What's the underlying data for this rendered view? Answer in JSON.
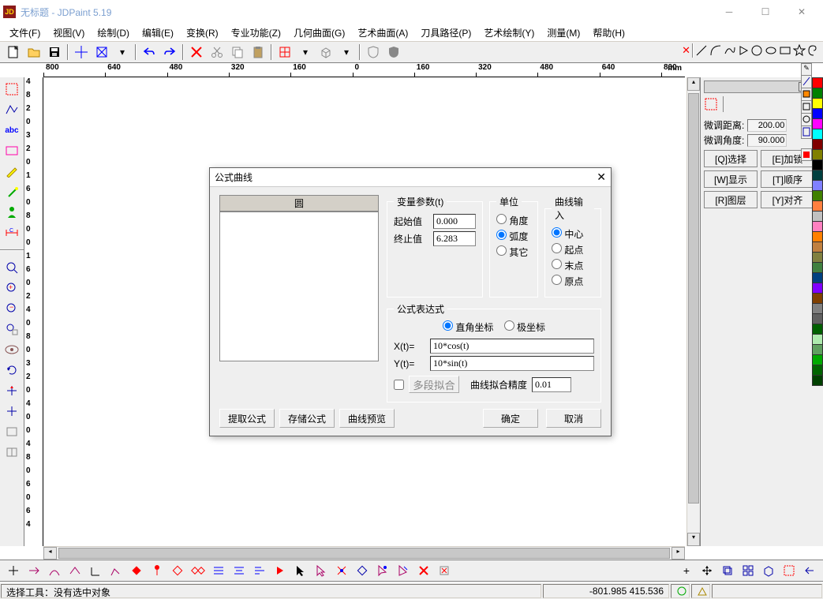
{
  "titlebar": {
    "title": "无标题 - JDPaint 5.19"
  },
  "menu": [
    "文件(F)",
    "视图(V)",
    "绘制(D)",
    "编辑(E)",
    "变换(R)",
    "专业功能(Z)",
    "几何曲面(G)",
    "艺术曲面(A)",
    "刀具路径(P)",
    "艺术绘制(Y)",
    "测量(M)",
    "帮助(H)"
  ],
  "ruler_h": {
    "labels": [
      "800",
      "640",
      "480",
      "320",
      "160",
      "0",
      "160",
      "320",
      "480",
      "640",
      "800"
    ],
    "unit": "mm"
  },
  "ruler_v": {
    "labels": [
      "4",
      "8",
      "2",
      "0",
      "3",
      "2",
      "0",
      "1",
      "6",
      "0",
      "8",
      "0",
      "0",
      "1",
      "6",
      "0",
      "2",
      "4",
      "0",
      "8",
      "0",
      "3",
      "2",
      "0",
      "4",
      "0",
      "0",
      "4",
      "8",
      "0",
      "6",
      "0",
      "6",
      "4"
    ]
  },
  "right_panel": {
    "dist_label": "微调距离:",
    "dist_value": "200.00",
    "angle_label": "微调角度:",
    "angle_value": "90.000",
    "buttons": [
      "[Q]选择",
      "[E]加锁",
      "[W]显示",
      "[T]顺序",
      "[R]图层",
      "[Y]对齐"
    ]
  },
  "dialog": {
    "title": "公式曲线",
    "list_header": "圆",
    "group_var": "变量参数(t)",
    "start_label": "起始值",
    "start_value": "0.000",
    "end_label": "终止值",
    "end_value": "6.283",
    "group_unit": "单位",
    "unit_options": [
      "角度",
      "弧度",
      "其它"
    ],
    "unit_selected": "弧度",
    "group_input": "曲线输入",
    "input_options": [
      "中心",
      "起点",
      "末点",
      "原点"
    ],
    "input_selected": "中心",
    "group_expr": "公式表达式",
    "coord_options": [
      "直角坐标",
      "极坐标"
    ],
    "coord_selected": "直角坐标",
    "x_label": "X(t)=",
    "x_value": "10*cos(t)",
    "y_label": "Y(t)=",
    "y_value": "10*sin(t)",
    "multi_label": "多段拟合",
    "precision_label": "曲线拟合精度",
    "precision_value": "0.01",
    "btn_extract": "提取公式",
    "btn_save": "存储公式",
    "btn_preview": "曲线预览",
    "btn_ok": "确定",
    "btn_cancel": "取消"
  },
  "status": {
    "left": "选择工具：没有选中对象",
    "coords": "-801.985 415.536"
  },
  "colors": [
    "#ff0000",
    "#008000",
    "#ffff00",
    "#0000ff",
    "#ff00ff",
    "#00ffff",
    "#800000",
    "#808000",
    "#000000",
    "#004040",
    "#8080ff",
    "#408000",
    "#ff8040",
    "#c0c0c0",
    "#ff80c0",
    "#ff8000",
    "#c08040",
    "#808040",
    "#408040",
    "#004080",
    "#8000ff",
    "#804000",
    "#808080",
    "#606060",
    "#006000",
    "#aeeaae",
    "#60a060",
    "#00aa00",
    "#006400",
    "#004000"
  ]
}
